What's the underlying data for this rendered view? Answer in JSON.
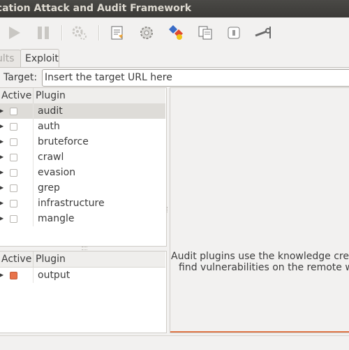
{
  "window": {
    "title": "ication Attack and Audit Framework"
  },
  "toolbar": {
    "buttons": [
      {
        "name": "play-icon"
      },
      {
        "name": "pause-icon"
      },
      {
        "name": "gears-icon"
      },
      {
        "name": "report-icon"
      },
      {
        "name": "config-gear-icon"
      },
      {
        "name": "profile-icon"
      },
      {
        "name": "copy-icon"
      },
      {
        "name": "export-icon"
      },
      {
        "name": "wrench-icon"
      }
    ]
  },
  "tabs": [
    {
      "label": "ults"
    },
    {
      "label": "Exploit"
    }
  ],
  "target": {
    "label": "Target:",
    "placeholder": "Insert the target URL here"
  },
  "plugins_top": {
    "col_active": "Active",
    "col_plugin": "Plugin",
    "rows": [
      {
        "name": "audit",
        "active": false,
        "selected": true
      },
      {
        "name": "auth",
        "active": false
      },
      {
        "name": "bruteforce",
        "active": false
      },
      {
        "name": "crawl",
        "active": false
      },
      {
        "name": "evasion",
        "active": false
      },
      {
        "name": "grep",
        "active": false
      },
      {
        "name": "infrastructure",
        "active": false
      },
      {
        "name": "mangle",
        "active": false
      }
    ]
  },
  "plugins_bottom": {
    "col_active": "Active",
    "col_plugin": "Plugin",
    "rows": [
      {
        "name": "output",
        "active": true
      }
    ]
  },
  "description": {
    "line1": "Audit plugins use the knowledge created",
    "line2": "find vulnerabilities on the remote web"
  },
  "colors": {
    "accent": "#e07747",
    "titlebar": "#3c3b37"
  }
}
